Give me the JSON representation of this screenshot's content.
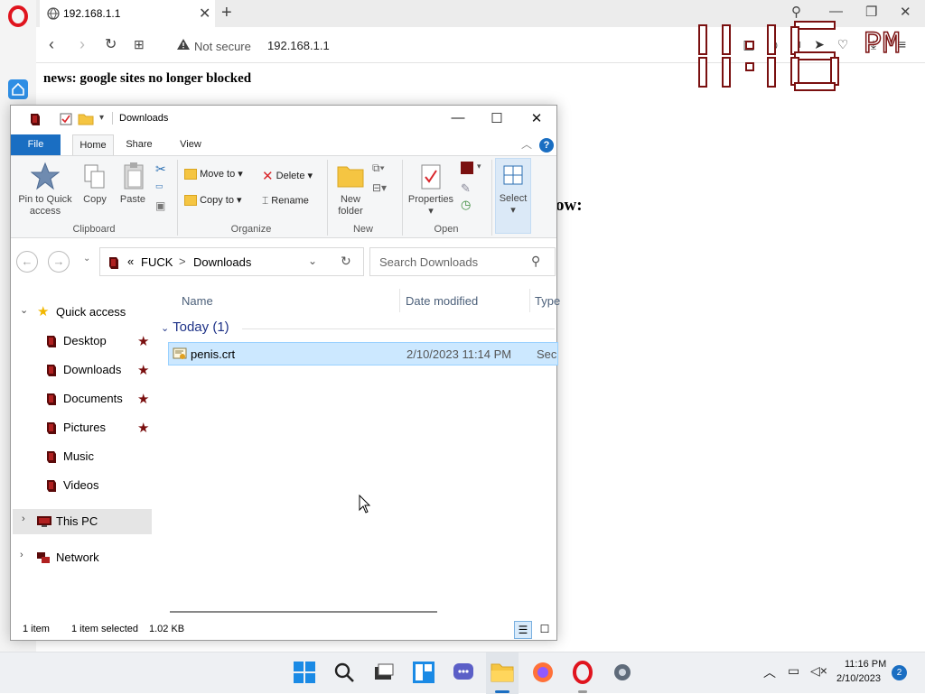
{
  "browser": {
    "tab_title": "192.168.1.1",
    "security_label": "Not secure",
    "url": "192.168.1.1"
  },
  "page": {
    "news": "news: google sites no longer blocked",
    "fragment": "ow:"
  },
  "clock_overlay": {
    "hours": "11",
    "minutes": "16",
    "ampm": "PM"
  },
  "explorer": {
    "title": "Downloads",
    "ribbon_tabs": [
      "File",
      "Home",
      "Share",
      "View"
    ],
    "ribbon": {
      "pin_label_1": "Pin to Quick",
      "pin_label_2": "access",
      "copy": "Copy",
      "paste": "Paste",
      "move_to": "Move to",
      "copy_to": "Copy to",
      "delete": "Delete",
      "rename": "Rename",
      "new_folder_1": "New",
      "new_folder_2": "folder",
      "properties": "Properties",
      "select": "Select",
      "groups": {
        "clipboard": "Clipboard",
        "organize": "Organize",
        "new": "New",
        "open": "Open"
      }
    },
    "path": {
      "prefix": "«",
      "root": "FUCK",
      "sep": ">",
      "current": "Downloads"
    },
    "search_placeholder": "Search Downloads",
    "nav": {
      "quick_access": "Quick access",
      "items": [
        "Desktop",
        "Downloads",
        "Documents",
        "Pictures",
        "Music",
        "Videos"
      ],
      "this_pc": "This PC",
      "network": "Network"
    },
    "columns": {
      "name": "Name",
      "date": "Date modified",
      "type": "Type"
    },
    "group": "Today (1)",
    "file": {
      "name": "penis.crt",
      "date": "2/10/2023 11:14 PM",
      "type": "Sec"
    },
    "status": {
      "count": "1 item",
      "selected": "1 item selected",
      "size": "1.02 KB"
    }
  },
  "taskbar": {
    "time": "11:16 PM",
    "date": "2/10/2023",
    "notifications": "2"
  },
  "colors": {
    "accent": "#1a6ec2",
    "opera_red": "#e0141e",
    "clock_red": "#7a1010",
    "selection": "#cce8ff"
  }
}
